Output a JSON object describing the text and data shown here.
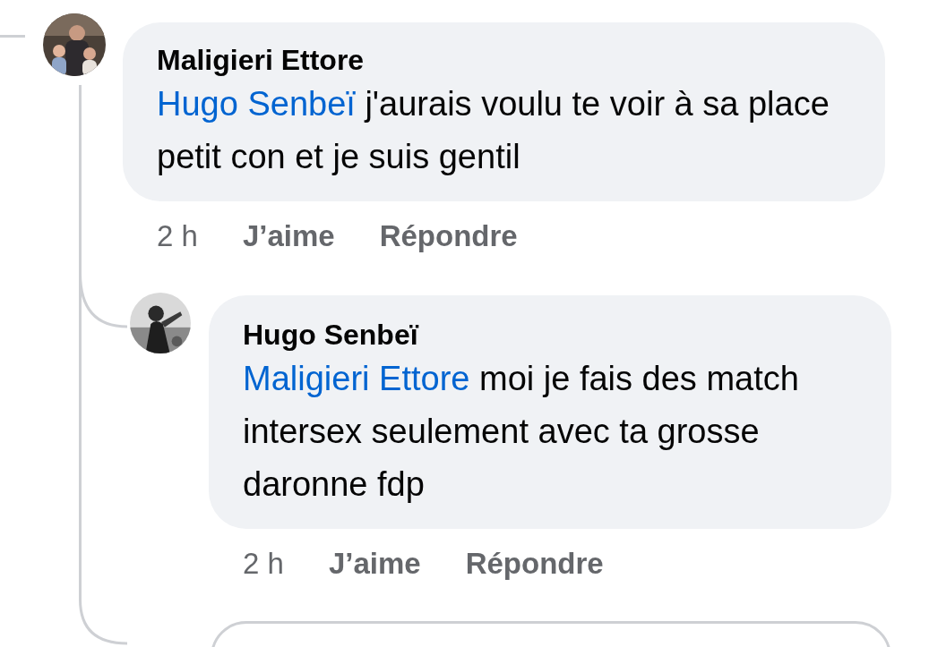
{
  "comments": [
    {
      "author": "Maligieri Ettore",
      "mention": "Hugo Senbeï",
      "text": "j'aurais voulu te voir à sa place petit con et je suis gentil",
      "time": "2 h",
      "like": "J’aime",
      "reply": "Répondre",
      "replies": [
        {
          "author": "Hugo Senbeï",
          "mention": "Maligieri Ettore",
          "text": "moi je fais des match intersex seulement avec ta grosse daronne fdp",
          "time": "2 h",
          "like": "J’aime",
          "reply": "Répondre"
        }
      ]
    }
  ],
  "composer": {
    "kind": "field"
  }
}
